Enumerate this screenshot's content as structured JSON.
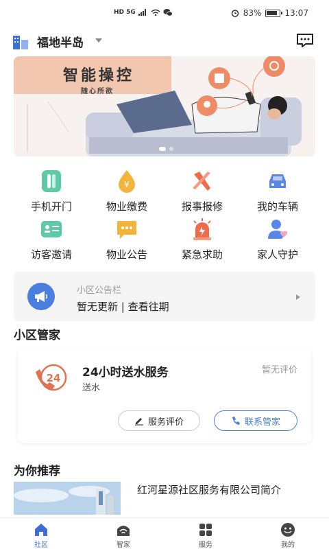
{
  "status": {
    "network": "HD 5G",
    "battery": "83%",
    "time": "13:07"
  },
  "header": {
    "community": "福地半岛"
  },
  "banner": {
    "title": "智能操控",
    "subtitle": "随心所欲"
  },
  "grid": [
    [
      {
        "label": "手机开门",
        "icon": "door-icon",
        "color": "#5ec9a6"
      },
      {
        "label": "物业缴费",
        "icon": "yen-drop-icon",
        "color": "#f2b43c"
      },
      {
        "label": "报事报修",
        "icon": "wrench-icon",
        "color": "#ef6b4a"
      },
      {
        "label": "我的车辆",
        "icon": "car-icon",
        "color": "#5a86e6"
      }
    ],
    [
      {
        "label": "访客邀请",
        "icon": "id-card-icon",
        "color": "#5ec9a6"
      },
      {
        "label": "物业公告",
        "icon": "chat-bubble-icon",
        "color": "#f2b43c"
      },
      {
        "label": "紧急求助",
        "icon": "siren-icon",
        "color": "#ef6b4a"
      },
      {
        "label": "家人守护",
        "icon": "heart-user-icon",
        "color": "#5a86e6"
      }
    ]
  ],
  "notice": {
    "title": "小区公告栏",
    "text": "暂无更新 | 查看往期"
  },
  "sections": {
    "butler": "小区管家",
    "recommend": "为你推荐"
  },
  "service": {
    "title": "24小时送水服务",
    "category": "送水",
    "rating": "暂无评价",
    "icon_text": "24",
    "evaluate": "服务评价",
    "contact": "联系管家"
  },
  "recommend": {
    "text": "红河星源社区服务有限公司简介"
  },
  "tabs": [
    {
      "label": "社区",
      "icon": "home-icon"
    },
    {
      "label": "智家",
      "icon": "wifi-home-icon"
    },
    {
      "label": "服务",
      "icon": "grid-icon"
    },
    {
      "label": "我的",
      "icon": "face-icon"
    }
  ],
  "colors": {
    "accent": "#3b6fd8",
    "blue": "#4a7fe0"
  }
}
